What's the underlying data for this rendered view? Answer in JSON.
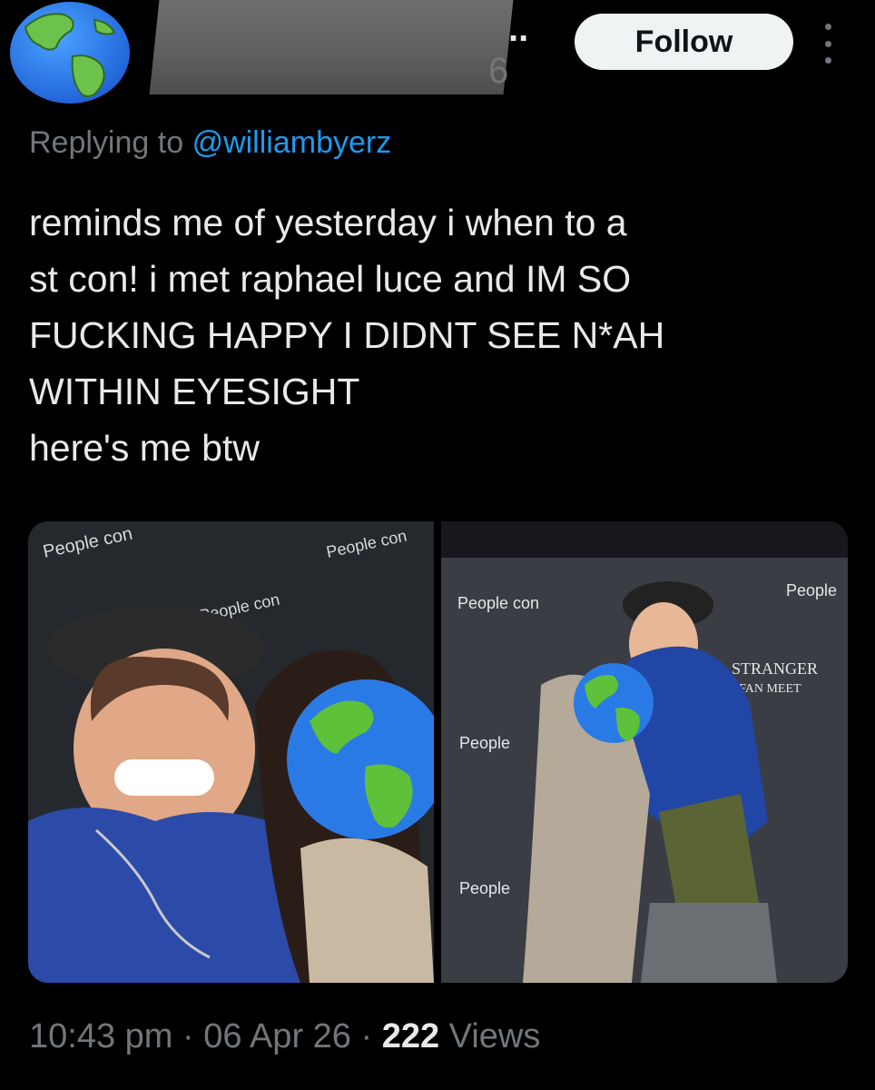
{
  "author": {
    "name_fragment": "",
    "name_truncation": "..",
    "handle_fragment": "@",
    "handle_end": "6"
  },
  "actions": {
    "follow_label": "Follow",
    "more_icon": "more-vertical-icon"
  },
  "reply": {
    "prefix": "Replying to",
    "mention": "@williambyerz"
  },
  "tweet": {
    "lines": [
      "reminds me of yesterday i when to a",
      "st con! i met raphael luce and IM SO",
      "FUCKING HAPPY I DIDNT SEE N*AH",
      "WITHIN EYESIGHT",
      "here's me btw"
    ]
  },
  "media": {
    "left_backdrop_text": "People con",
    "right_backdrop_texts": [
      "People con",
      "STRANGER",
      "FAN MEET",
      "People"
    ]
  },
  "meta": {
    "time": "10:43 pm",
    "sep": "·",
    "date": "06 Apr 26",
    "views_count": "222",
    "views_label": "Views"
  },
  "colors": {
    "background": "#000000",
    "primary_text": "#e7e9ea",
    "secondary_text": "#71767b",
    "link": "#1d9bf0",
    "follow_bg": "#eff3f4"
  }
}
